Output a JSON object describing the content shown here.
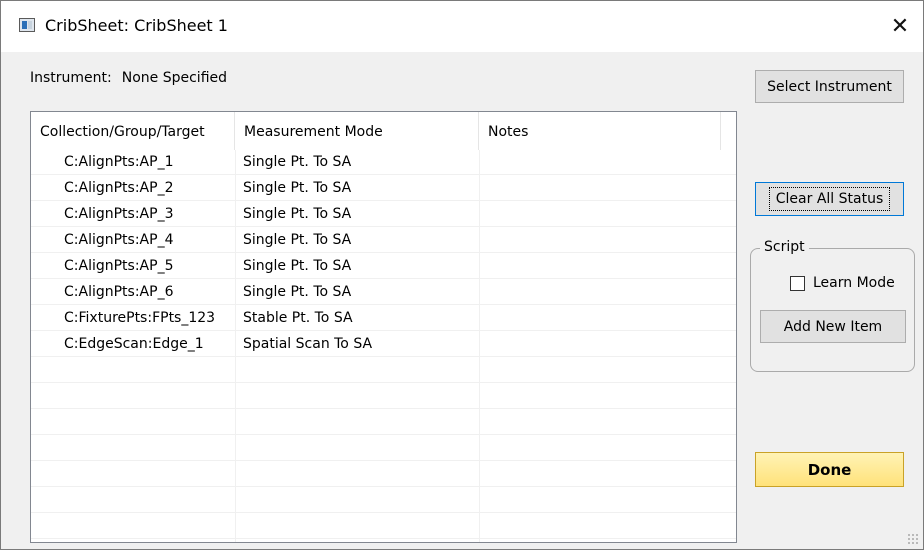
{
  "window": {
    "title": "CribSheet: CribSheet 1",
    "close_glyph": "✕"
  },
  "instrument": {
    "label": "Instrument:",
    "value": "None Specified"
  },
  "table": {
    "columns": [
      "Collection/Group/Target",
      "Measurement Mode",
      "Notes"
    ],
    "rows": [
      {
        "target": "C:AlignPts:AP_1",
        "mode": "Single Pt. To SA",
        "notes": ""
      },
      {
        "target": "C:AlignPts:AP_2",
        "mode": "Single Pt. To SA",
        "notes": ""
      },
      {
        "target": "C:AlignPts:AP_3",
        "mode": "Single Pt. To SA",
        "notes": ""
      },
      {
        "target": "C:AlignPts:AP_4",
        "mode": "Single Pt. To SA",
        "notes": ""
      },
      {
        "target": "C:AlignPts:AP_5",
        "mode": "Single Pt. To SA",
        "notes": ""
      },
      {
        "target": "C:AlignPts:AP_6",
        "mode": "Single Pt. To SA",
        "notes": ""
      },
      {
        "target": "C:FixturePts:FPts_123",
        "mode": "Stable Pt. To SA",
        "notes": ""
      },
      {
        "target": "C:EdgeScan:Edge_1",
        "mode": "Spatial Scan To SA",
        "notes": ""
      }
    ]
  },
  "buttons": {
    "select_instrument": "Select Instrument",
    "clear_all_status": "Clear All Status",
    "add_new_item": "Add New Item",
    "done": "Done"
  },
  "script": {
    "group_label": "Script",
    "learn_mode_label": "Learn Mode",
    "learn_mode_checked": false
  },
  "colors": {
    "done_button": "#ffe27a",
    "focus_border": "#0078d7",
    "window_bg": "#f0f0f0"
  },
  "icons": {
    "app": "app-window-icon",
    "close": "close-icon",
    "resize": "resize-grip-icon"
  }
}
